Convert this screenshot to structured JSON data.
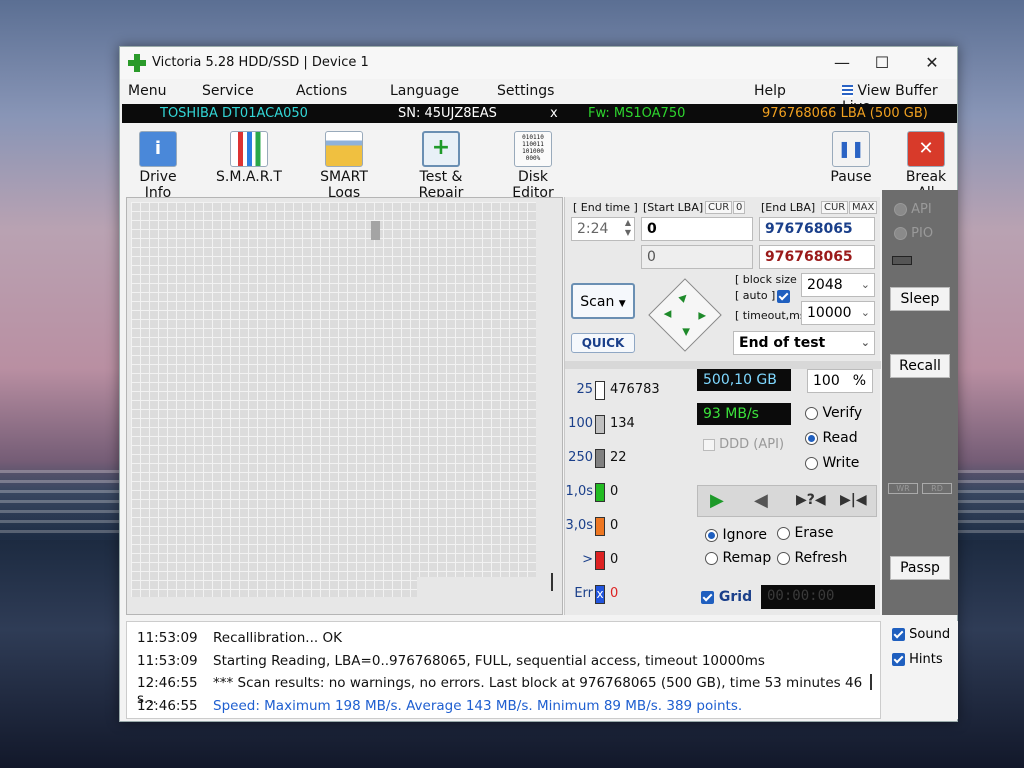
{
  "window": {
    "title": "Victoria 5.28 HDD/SSD | Device 1",
    "minimize": "—",
    "maximize": "☐",
    "close": "✕"
  },
  "menu": {
    "items": [
      "Menu",
      "Service",
      "Actions",
      "Language",
      "Settings",
      "Help"
    ],
    "view_buffer": "View Buffer Live"
  },
  "drive": {
    "model": "TOSHIBA DT01ACA050",
    "serial": "SN: 45UJZ8EAS",
    "x": "x",
    "firmware": "Fw: MS1OA750",
    "capacity": "976768066 LBA (500 GB)",
    "colors": {
      "model": "#33d6d6",
      "serial": "#ffffff",
      "firmware": "#2ed52e",
      "capacity": "#f0a020"
    }
  },
  "toolbar": {
    "items": [
      {
        "label": "Drive Info",
        "icon": "info-icon"
      },
      {
        "label": "S.M.A.R.T",
        "icon": "smart-bars-icon"
      },
      {
        "label": "SMART Logs",
        "icon": "folder-icon"
      },
      {
        "label": "Test & Repair",
        "icon": "plus-medical-icon"
      },
      {
        "label": "Disk Editor",
        "icon": "binary-file-icon"
      }
    ],
    "pause": "Pause",
    "break_all": "Break All",
    "editor_bits": "010110\n110011\n101000\n000%"
  },
  "scan": {
    "end_time_label": "[ End time ]",
    "end_time": "2:24",
    "start_lba_label": "[Start LBA]",
    "cur_label": "CUR",
    "cur_value": "0",
    "start_lba": "0",
    "start_lba2": "0",
    "end_lba_label": "[End LBA]",
    "end_cur_label": "CUR",
    "max_label": "MAX",
    "end_lba": "976768065",
    "end_lba2": "976768065",
    "scan_button": "Scan",
    "quick_button": "QUICK",
    "block_size_label": "[ block size ]",
    "auto_label": "[ auto ]",
    "block_size": "2048",
    "timeout_label": "[ timeout,ms ]",
    "timeout": "10000",
    "end_action": "End of test"
  },
  "stats": [
    {
      "label": "25",
      "count": "476783",
      "color": "#ffffff"
    },
    {
      "label": "100",
      "count": "134",
      "color": "#c0c0c0"
    },
    {
      "label": "250",
      "count": "22",
      "color": "#808080"
    },
    {
      "label": "1,0s",
      "count": "0",
      "color": "#22bb22"
    },
    {
      "label": "3,0s",
      "count": "0",
      "color": "#ee7722"
    },
    {
      "label": ">",
      "count": "0",
      "color": "#dd2222"
    },
    {
      "label": "Err",
      "count": "0",
      "color": "#2255dd"
    }
  ],
  "progress": {
    "size": "500,10 GB",
    "percent": "100",
    "percent_sign": "%",
    "speed": "93 MB/s",
    "ddd": "DDD (API)"
  },
  "mode": {
    "verify": "Verify",
    "read": "Read",
    "write": "Write",
    "selected": "Read"
  },
  "repair": {
    "ignore": "Ignore",
    "erase": "Erase",
    "remap": "Remap",
    "refresh": "Refresh",
    "selected": "Ignore"
  },
  "grid": {
    "label": "Grid",
    "timer": "00:00:00"
  },
  "sidebar": {
    "api": "API",
    "pio": "PIO",
    "sleep": "Sleep",
    "recall": "Recall",
    "passp": "Passp",
    "wr": "WR",
    "rd": "RD"
  },
  "options": {
    "sound": "Sound",
    "hints": "Hints"
  },
  "log": [
    {
      "time": "11:53:09",
      "text": "Recallibration... OK",
      "color": "#111111"
    },
    {
      "time": "11:53:09",
      "text": "Starting Reading, LBA=0..976768065, FULL, sequential access, timeout 10000ms",
      "color": "#111111"
    },
    {
      "time": "12:46:55",
      "text": "*** Scan results: no warnings, no errors. Last block at 976768065 (500 GB), time 53 minutes 46 s...",
      "color": "#111111"
    },
    {
      "time": "12:46:55",
      "text": "Speed: Maximum 198 MB/s. Average 143 MB/s. Minimum 89 MB/s. 389 points.",
      "color": "#1f5fd0"
    }
  ]
}
